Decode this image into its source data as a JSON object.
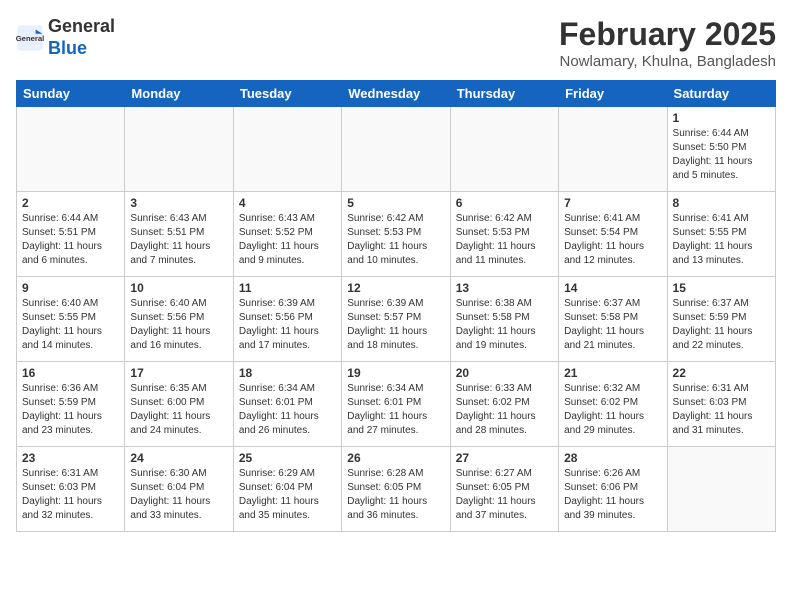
{
  "header": {
    "logo_line1": "General",
    "logo_line2": "Blue",
    "month": "February 2025",
    "location": "Nowlamary, Khulna, Bangladesh"
  },
  "weekdays": [
    "Sunday",
    "Monday",
    "Tuesday",
    "Wednesday",
    "Thursday",
    "Friday",
    "Saturday"
  ],
  "weeks": [
    [
      {
        "day": "",
        "info": ""
      },
      {
        "day": "",
        "info": ""
      },
      {
        "day": "",
        "info": ""
      },
      {
        "day": "",
        "info": ""
      },
      {
        "day": "",
        "info": ""
      },
      {
        "day": "",
        "info": ""
      },
      {
        "day": "1",
        "info": "Sunrise: 6:44 AM\nSunset: 5:50 PM\nDaylight: 11 hours and 5 minutes."
      }
    ],
    [
      {
        "day": "2",
        "info": "Sunrise: 6:44 AM\nSunset: 5:51 PM\nDaylight: 11 hours and 6 minutes."
      },
      {
        "day": "3",
        "info": "Sunrise: 6:43 AM\nSunset: 5:51 PM\nDaylight: 11 hours and 7 minutes."
      },
      {
        "day": "4",
        "info": "Sunrise: 6:43 AM\nSunset: 5:52 PM\nDaylight: 11 hours and 9 minutes."
      },
      {
        "day": "5",
        "info": "Sunrise: 6:42 AM\nSunset: 5:53 PM\nDaylight: 11 hours and 10 minutes."
      },
      {
        "day": "6",
        "info": "Sunrise: 6:42 AM\nSunset: 5:53 PM\nDaylight: 11 hours and 11 minutes."
      },
      {
        "day": "7",
        "info": "Sunrise: 6:41 AM\nSunset: 5:54 PM\nDaylight: 11 hours and 12 minutes."
      },
      {
        "day": "8",
        "info": "Sunrise: 6:41 AM\nSunset: 5:55 PM\nDaylight: 11 hours and 13 minutes."
      }
    ],
    [
      {
        "day": "9",
        "info": "Sunrise: 6:40 AM\nSunset: 5:55 PM\nDaylight: 11 hours and 14 minutes."
      },
      {
        "day": "10",
        "info": "Sunrise: 6:40 AM\nSunset: 5:56 PM\nDaylight: 11 hours and 16 minutes."
      },
      {
        "day": "11",
        "info": "Sunrise: 6:39 AM\nSunset: 5:56 PM\nDaylight: 11 hours and 17 minutes."
      },
      {
        "day": "12",
        "info": "Sunrise: 6:39 AM\nSunset: 5:57 PM\nDaylight: 11 hours and 18 minutes."
      },
      {
        "day": "13",
        "info": "Sunrise: 6:38 AM\nSunset: 5:58 PM\nDaylight: 11 hours and 19 minutes."
      },
      {
        "day": "14",
        "info": "Sunrise: 6:37 AM\nSunset: 5:58 PM\nDaylight: 11 hours and 21 minutes."
      },
      {
        "day": "15",
        "info": "Sunrise: 6:37 AM\nSunset: 5:59 PM\nDaylight: 11 hours and 22 minutes."
      }
    ],
    [
      {
        "day": "16",
        "info": "Sunrise: 6:36 AM\nSunset: 5:59 PM\nDaylight: 11 hours and 23 minutes."
      },
      {
        "day": "17",
        "info": "Sunrise: 6:35 AM\nSunset: 6:00 PM\nDaylight: 11 hours and 24 minutes."
      },
      {
        "day": "18",
        "info": "Sunrise: 6:34 AM\nSunset: 6:01 PM\nDaylight: 11 hours and 26 minutes."
      },
      {
        "day": "19",
        "info": "Sunrise: 6:34 AM\nSunset: 6:01 PM\nDaylight: 11 hours and 27 minutes."
      },
      {
        "day": "20",
        "info": "Sunrise: 6:33 AM\nSunset: 6:02 PM\nDaylight: 11 hours and 28 minutes."
      },
      {
        "day": "21",
        "info": "Sunrise: 6:32 AM\nSunset: 6:02 PM\nDaylight: 11 hours and 29 minutes."
      },
      {
        "day": "22",
        "info": "Sunrise: 6:31 AM\nSunset: 6:03 PM\nDaylight: 11 hours and 31 minutes."
      }
    ],
    [
      {
        "day": "23",
        "info": "Sunrise: 6:31 AM\nSunset: 6:03 PM\nDaylight: 11 hours and 32 minutes."
      },
      {
        "day": "24",
        "info": "Sunrise: 6:30 AM\nSunset: 6:04 PM\nDaylight: 11 hours and 33 minutes."
      },
      {
        "day": "25",
        "info": "Sunrise: 6:29 AM\nSunset: 6:04 PM\nDaylight: 11 hours and 35 minutes."
      },
      {
        "day": "26",
        "info": "Sunrise: 6:28 AM\nSunset: 6:05 PM\nDaylight: 11 hours and 36 minutes."
      },
      {
        "day": "27",
        "info": "Sunrise: 6:27 AM\nSunset: 6:05 PM\nDaylight: 11 hours and 37 minutes."
      },
      {
        "day": "28",
        "info": "Sunrise: 6:26 AM\nSunset: 6:06 PM\nDaylight: 11 hours and 39 minutes."
      },
      {
        "day": "",
        "info": ""
      }
    ]
  ]
}
